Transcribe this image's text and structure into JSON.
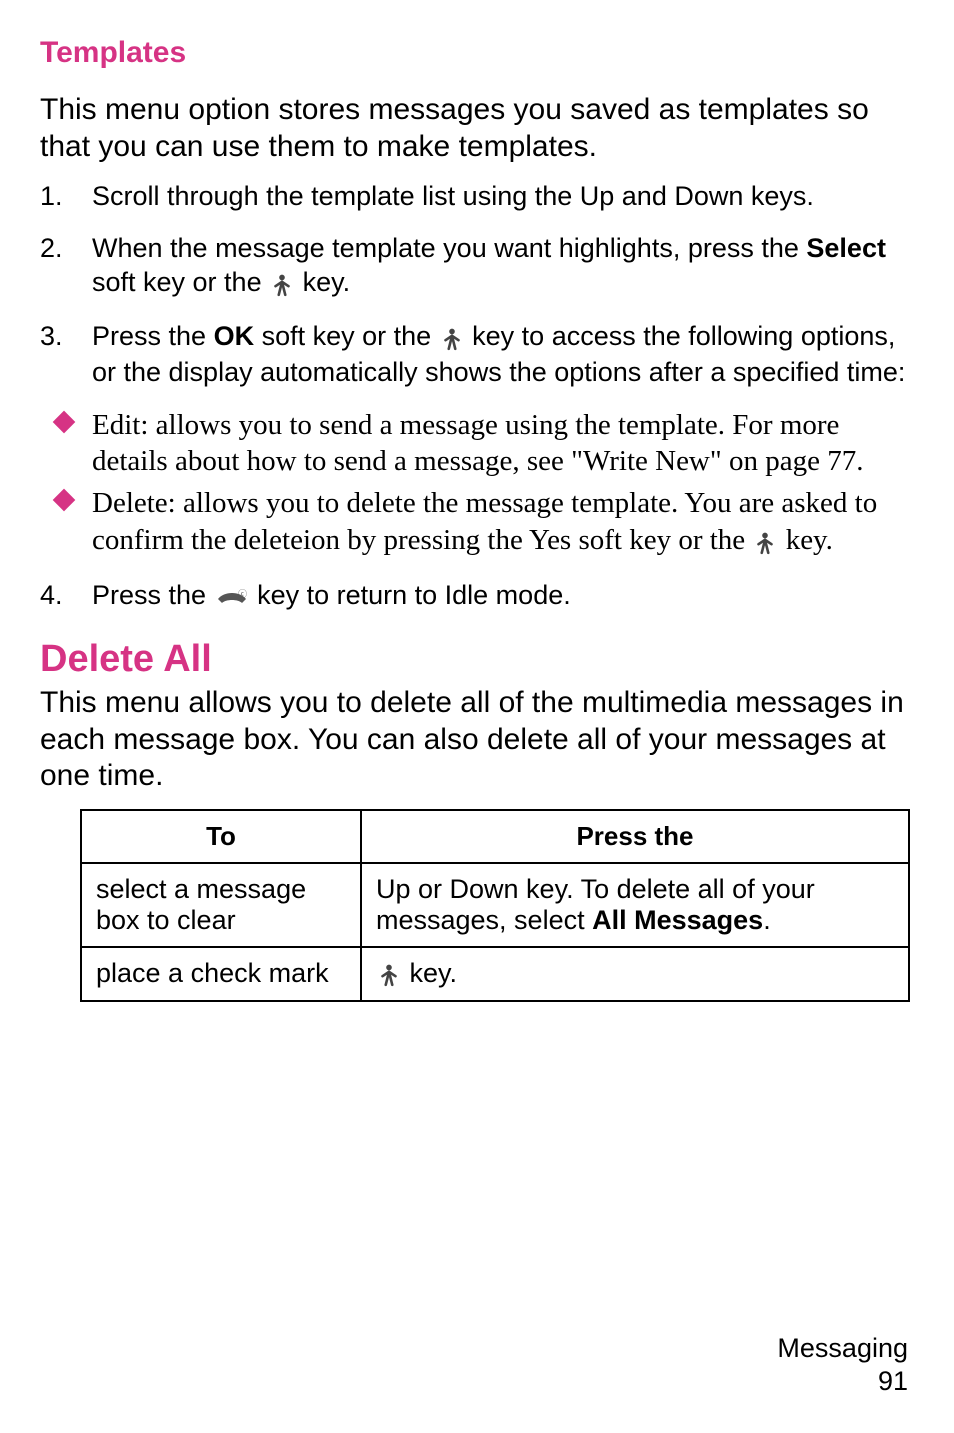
{
  "sections": {
    "templates": {
      "heading": "Templates",
      "intro": "This menu option stores messages you saved as templates so that you can use them to make templates.",
      "step1": "Scroll through the template list using the Up and Down keys.",
      "step2_a": "When the message template you want highlights, press the ",
      "step2_select": "Select",
      "step2_b": " soft key or the ",
      "step2_c": " key.",
      "step3_a": "Press the ",
      "step3_ok": "OK",
      "step3_b": " soft key or the ",
      "step3_c": " key to access the following options, or the display automatically shows the options after a specified time:",
      "bullets": {
        "edit": "Edit: allows you to send a message using the template. For more details about how to send a message, see \"Write New\" on page 77.",
        "delete_a": "Delete: allows you to delete the message template. You are asked to confirm the deleteion by pressing the Yes soft key or the ",
        "delete_b": " key."
      },
      "step4_a": "Press the ",
      "step4_b": " key to return to Idle mode."
    },
    "deleteAll": {
      "heading": "Delete All",
      "intro": "This menu allows you to delete all of the multimedia messages in each message box. You can also delete all of your messages at one time.",
      "table": {
        "h_to": "To",
        "h_press": "Press the",
        "r1_to": "select a message box to clear",
        "r1_press_a": "Up or Down key. To delete all of your messages, select ",
        "r1_press_b": "All Messages",
        "r1_press_c": ".",
        "r2_to": "place a check mark",
        "r2_press": " key."
      }
    }
  },
  "footer": {
    "section": "Messaging",
    "page": "91"
  },
  "icons": {
    "ok_key": "ok-person-icon",
    "end_key": "end-call-icon"
  }
}
